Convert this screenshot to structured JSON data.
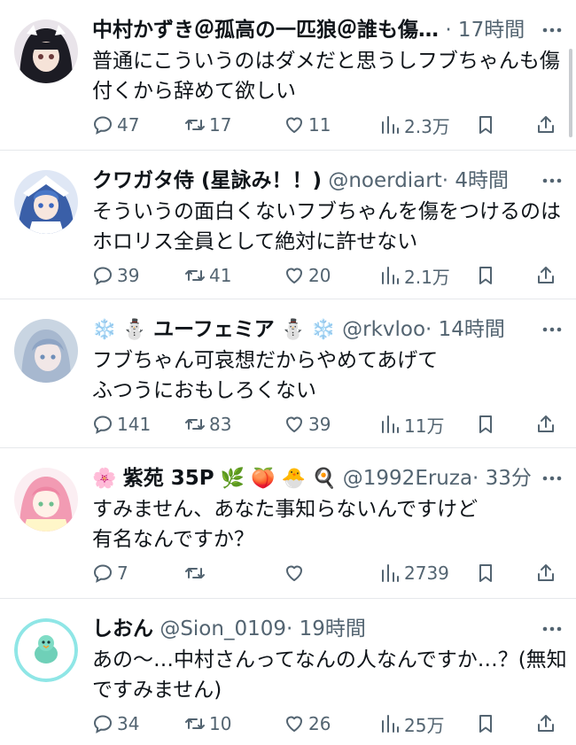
{
  "tweets": [
    {
      "name": "中村かずき＠孤高の一匹狼＠誰も傷…",
      "handle": "",
      "time": "· 17時間",
      "name_prefix_emojis": "",
      "name_suffix_emojis": "",
      "body": [
        "普通にこういうのはダメだと思うしフブちゃんも傷",
        "付くから辞めて欲しい"
      ],
      "reply_count": "47",
      "retweet_count": "17",
      "like_count": "11",
      "view_count": "2.3万",
      "avatar_color": "#1c1c24"
    },
    {
      "name": "クワガタ侍 (星詠み！！)",
      "handle": "@noerdiart",
      "time": "· 4時間",
      "name_prefix_emojis": "",
      "name_suffix_emojis": "",
      "body": [
        "そういうの面白くないフブちゃんを傷をつけるのは",
        "ホロリス全員として絶対に許せない"
      ],
      "reply_count": "39",
      "retweet_count": "41",
      "like_count": "20",
      "view_count": "2.1万",
      "avatar_color": "#3a5fa8"
    },
    {
      "name": "ユーフェミア",
      "handle": "@rkvloo",
      "time": "· 14時間",
      "name_prefix_emojis": "❄️ ⛄",
      "name_suffix_emojis": "⛄ ❄️",
      "body": [
        "フブちゃん可哀想だからやめてあげて",
        "ふつうにおもしろくない"
      ],
      "reply_count": "141",
      "retweet_count": "83",
      "like_count": "39",
      "view_count": "11万",
      "avatar_color": "#b7c6d6"
    },
    {
      "name": "紫苑 35P",
      "handle": "@1992Eruza",
      "time": "· 33分",
      "name_prefix_emojis": "🌸",
      "name_suffix_emojis": "🌿 🍑 🐣 🍳",
      "body": [
        "すみません、あなた事知らないんですけど",
        "有名なんですか？"
      ],
      "reply_count": "7",
      "retweet_count": "",
      "like_count": "",
      "view_count": "2739",
      "avatar_color": "#f5c9d6"
    },
    {
      "name": "しおん",
      "handle": "@Sion_0109",
      "time": "· 19時間",
      "name_prefix_emojis": "",
      "name_suffix_emojis": "",
      "body": [
        "あの〜…中村さんってなんの人なんですか…？(無知",
        "ですみません)"
      ],
      "reply_count": "34",
      "retweet_count": "10",
      "like_count": "26",
      "view_count": "25万",
      "avatar_color": "#8fe6e6"
    }
  ]
}
